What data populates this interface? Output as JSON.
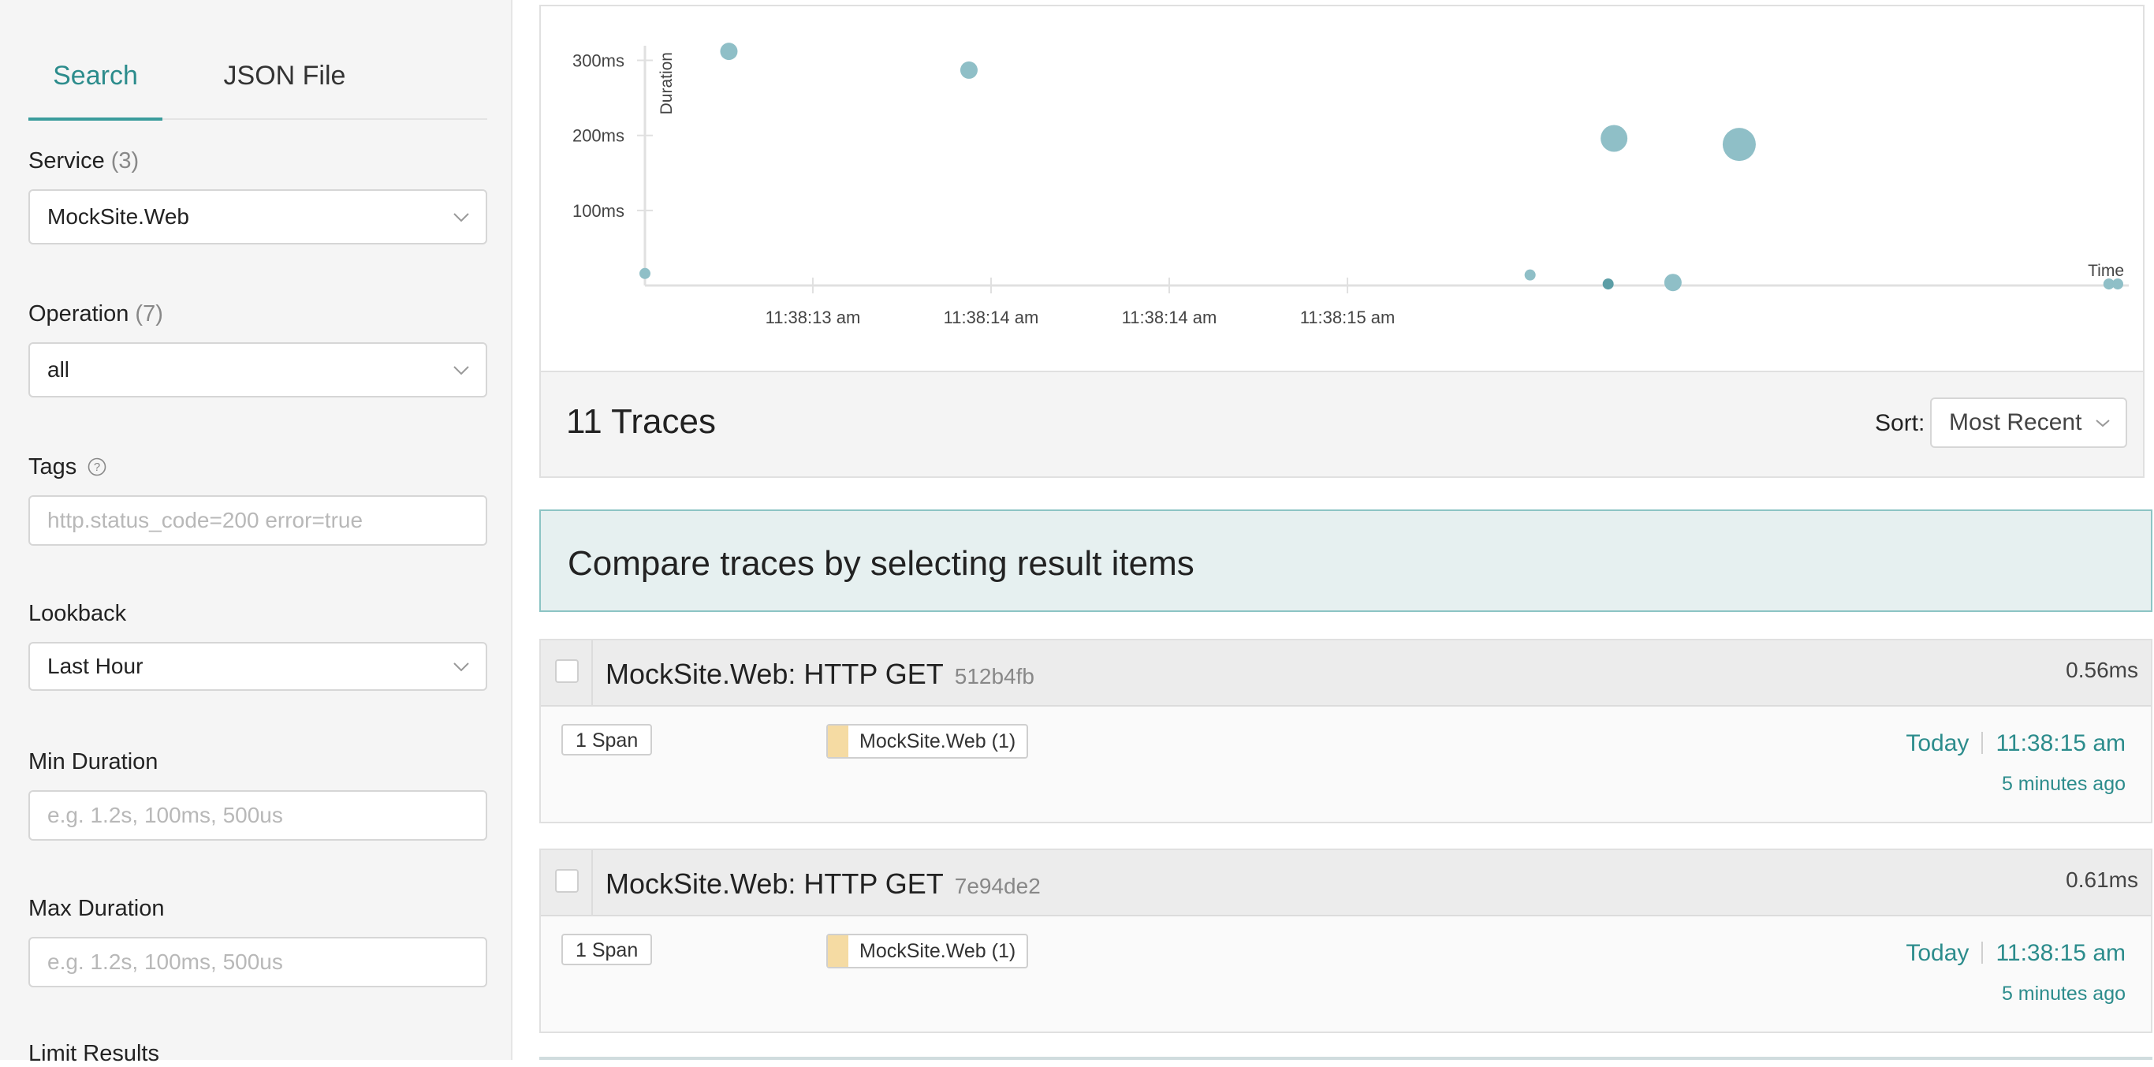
{
  "sidebar": {
    "tabs": [
      {
        "label": "Search",
        "active": true
      },
      {
        "label": "JSON File",
        "active": false
      }
    ],
    "service": {
      "label": "Service",
      "count": "(3)",
      "value": "MockSite.Web"
    },
    "operation": {
      "label": "Operation",
      "count": "(7)",
      "value": "all"
    },
    "tags": {
      "label": "Tags",
      "placeholder": "http.status_code=200 error=true"
    },
    "lookback": {
      "label": "Lookback",
      "value": "Last Hour"
    },
    "min_duration": {
      "label": "Min Duration",
      "placeholder": "e.g. 1.2s, 100ms, 500us"
    },
    "max_duration": {
      "label": "Max Duration",
      "placeholder": "e.g. 1.2s, 100ms, 500us"
    },
    "limit_results": {
      "label": "Limit Results"
    }
  },
  "chart_data": {
    "type": "scatter",
    "xlabel": "Time",
    "ylabel": "Duration",
    "y_ticks": [
      "300ms",
      "200ms",
      "100ms"
    ],
    "y_tick_values": [
      300,
      200,
      100
    ],
    "x_ticks": [
      "11:38:13 am",
      "11:38:14 am",
      "11:38:14 am",
      "11:38:15 am"
    ],
    "y_range": [
      0,
      330
    ],
    "x_range": [
      0,
      1
    ],
    "points_color": "#8fbfc7",
    "points": [
      {
        "x": 0.0,
        "y": 16,
        "size": 1
      },
      {
        "x": 0.057,
        "y": 312,
        "size": 2
      },
      {
        "x": 0.22,
        "y": 287,
        "size": 2
      },
      {
        "x": 0.601,
        "y": 14,
        "size": 1
      },
      {
        "x": 0.654,
        "y": 2,
        "size": 1,
        "dark": true
      },
      {
        "x": 0.658,
        "y": 196,
        "size": 3
      },
      {
        "x": 0.698,
        "y": 4,
        "size": 2
      },
      {
        "x": 0.743,
        "y": 188,
        "size": 4
      },
      {
        "x": 0.994,
        "y": 2,
        "size": 1
      },
      {
        "x": 1.0,
        "y": 2,
        "size": 1
      }
    ]
  },
  "results": {
    "count_label": "11 Traces",
    "sort_label": "Sort:",
    "sort_value": "Most Recent"
  },
  "compare_banner": "Compare traces by selecting result items",
  "traces": [
    {
      "title": "MockSite.Web: HTTP GET",
      "id": "512b4fb",
      "duration": "0.56ms",
      "spans": "1 Span",
      "service": "MockSite.Web (1)",
      "service_color": "#f5dba3",
      "date": "Today",
      "time": "11:38:15 am",
      "ago": "5 minutes ago"
    },
    {
      "title": "MockSite.Web: HTTP GET",
      "id": "7e94de2",
      "duration": "0.61ms",
      "spans": "1 Span",
      "service": "MockSite.Web (1)",
      "service_color": "#f5dba3",
      "date": "Today",
      "time": "11:38:15 am",
      "ago": "5 minutes ago"
    }
  ],
  "accent_color": "#2c8c8c"
}
